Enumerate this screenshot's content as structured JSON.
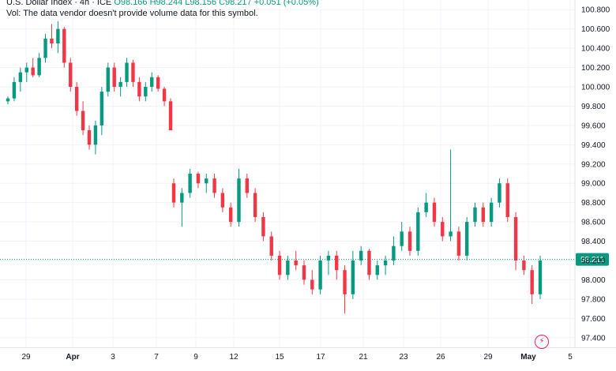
{
  "legend": {
    "symbol": "U.S. Dollar Index · 4h · ICE",
    "ohlc": "O98.166 H98.244 L98.156 C98.217 +0.051 (+0.05%)",
    "volume_note": "Vol: The data vendor doesn't provide volume data for this symbol."
  },
  "colors": {
    "up": "#089981",
    "down": "#f23645",
    "grid": "#f0f3fa",
    "price_line": "#089981"
  },
  "icons": {
    "bolt": "lightning-bolt-icon"
  },
  "bolt_glyph": "⚡",
  "chart_data": {
    "type": "candlestick",
    "ylim": [
      97.3,
      100.9
    ],
    "y_ticks": [
      "100.800",
      "100.600",
      "100.400",
      "100.200",
      "100.000",
      "99.800",
      "99.600",
      "99.400",
      "99.200",
      "99.000",
      "98.800",
      "98.600",
      "98.400",
      "98.200",
      "98.000",
      "97.800",
      "97.600",
      "97.400"
    ],
    "x_ticks": [
      "29",
      "Apr",
      "3",
      "7",
      "9",
      "12",
      "15",
      "17",
      "21",
      "23",
      "26",
      "29",
      "May",
      "5"
    ],
    "last_price": "98.211",
    "candles": [
      [
        99.85,
        99.9,
        99.82,
        99.88
      ],
      [
        99.88,
        100.1,
        99.85,
        100.05
      ],
      [
        100.05,
        100.2,
        99.95,
        100.15
      ],
      [
        100.15,
        100.25,
        100.05,
        100.2
      ],
      [
        100.2,
        100.3,
        100.1,
        100.12
      ],
      [
        100.12,
        100.35,
        100.1,
        100.3
      ],
      [
        100.3,
        100.55,
        100.25,
        100.5
      ],
      [
        100.5,
        100.65,
        100.4,
        100.45
      ],
      [
        100.45,
        100.68,
        100.35,
        100.6
      ],
      [
        100.6,
        100.62,
        100.2,
        100.25
      ],
      [
        100.25,
        100.3,
        99.95,
        100.0
      ],
      [
        100.0,
        100.05,
        99.7,
        99.75
      ],
      [
        99.75,
        99.85,
        99.5,
        99.55
      ],
      [
        99.55,
        99.6,
        99.35,
        99.4
      ],
      [
        99.4,
        99.65,
        99.3,
        99.6
      ],
      [
        99.6,
        100.0,
        99.5,
        99.95
      ],
      [
        99.95,
        100.25,
        99.9,
        100.2
      ],
      [
        100.2,
        100.25,
        99.95,
        100.0
      ],
      [
        100.0,
        100.1,
        99.9,
        100.05
      ],
      [
        100.05,
        100.3,
        100.0,
        100.25
      ],
      [
        100.25,
        100.28,
        100.0,
        100.05
      ],
      [
        100.05,
        100.1,
        99.85,
        99.9
      ],
      [
        99.9,
        100.05,
        99.85,
        100.0
      ],
      [
        100.0,
        100.15,
        99.95,
        100.1
      ],
      [
        100.1,
        100.12,
        99.95,
        99.98
      ],
      [
        99.98,
        100.0,
        99.8,
        99.85
      ],
      [
        99.85,
        99.88,
        99.55,
        99.55
      ],
      [
        99.0,
        99.05,
        98.75,
        98.8
      ],
      [
        98.8,
        98.95,
        98.55,
        98.9
      ],
      [
        98.9,
        99.15,
        98.85,
        99.1
      ],
      [
        99.1,
        99.12,
        98.95,
        99.0
      ],
      [
        99.0,
        99.1,
        98.9,
        99.05
      ],
      [
        99.05,
        99.1,
        98.85,
        98.9
      ],
      [
        98.9,
        98.95,
        98.7,
        98.75
      ],
      [
        98.75,
        98.8,
        98.55,
        98.6
      ],
      [
        98.6,
        99.15,
        98.55,
        99.05
      ],
      [
        99.05,
        99.1,
        98.85,
        98.9
      ],
      [
        98.9,
        98.95,
        98.6,
        98.65
      ],
      [
        98.65,
        98.7,
        98.4,
        98.45
      ],
      [
        98.45,
        98.5,
        98.2,
        98.25
      ],
      [
        98.25,
        98.3,
        98.0,
        98.05
      ],
      [
        98.05,
        98.25,
        98.0,
        98.2
      ],
      [
        98.2,
        98.3,
        98.1,
        98.15
      ],
      [
        98.15,
        98.2,
        97.95,
        98.0
      ],
      [
        98.0,
        98.1,
        97.85,
        97.9
      ],
      [
        97.9,
        98.25,
        97.85,
        98.2
      ],
      [
        98.2,
        98.3,
        98.05,
        98.25
      ],
      [
        98.25,
        98.3,
        98.0,
        98.1
      ],
      [
        98.1,
        98.15,
        97.65,
        97.85
      ],
      [
        97.85,
        98.3,
        97.8,
        98.2
      ],
      [
        98.2,
        98.35,
        98.15,
        98.3
      ],
      [
        98.3,
        98.32,
        98.0,
        98.05
      ],
      [
        98.05,
        98.2,
        98.0,
        98.15
      ],
      [
        98.15,
        98.25,
        98.05,
        98.2
      ],
      [
        98.2,
        98.45,
        98.15,
        98.35
      ],
      [
        98.35,
        98.6,
        98.3,
        98.5
      ],
      [
        98.5,
        98.55,
        98.25,
        98.3
      ],
      [
        98.3,
        98.75,
        98.25,
        98.7
      ],
      [
        98.7,
        98.9,
        98.65,
        98.8
      ],
      [
        98.8,
        98.85,
        98.55,
        98.6
      ],
      [
        98.6,
        98.65,
        98.4,
        98.45
      ],
      [
        98.45,
        99.35,
        98.4,
        98.5
      ],
      [
        98.5,
        98.55,
        98.2,
        98.25
      ],
      [
        98.25,
        98.65,
        98.2,
        98.6
      ],
      [
        98.6,
        98.8,
        98.55,
        98.75
      ],
      [
        98.75,
        98.8,
        98.55,
        98.6
      ],
      [
        98.6,
        98.85,
        98.55,
        98.8
      ],
      [
        98.8,
        99.05,
        98.75,
        99.0
      ],
      [
        99.0,
        99.05,
        98.6,
        98.65
      ],
      [
        98.65,
        98.7,
        98.1,
        98.2
      ],
      [
        98.2,
        98.25,
        98.05,
        98.1
      ],
      [
        98.1,
        98.15,
        97.75,
        97.85
      ],
      [
        97.85,
        98.25,
        97.8,
        98.2
      ]
    ]
  }
}
